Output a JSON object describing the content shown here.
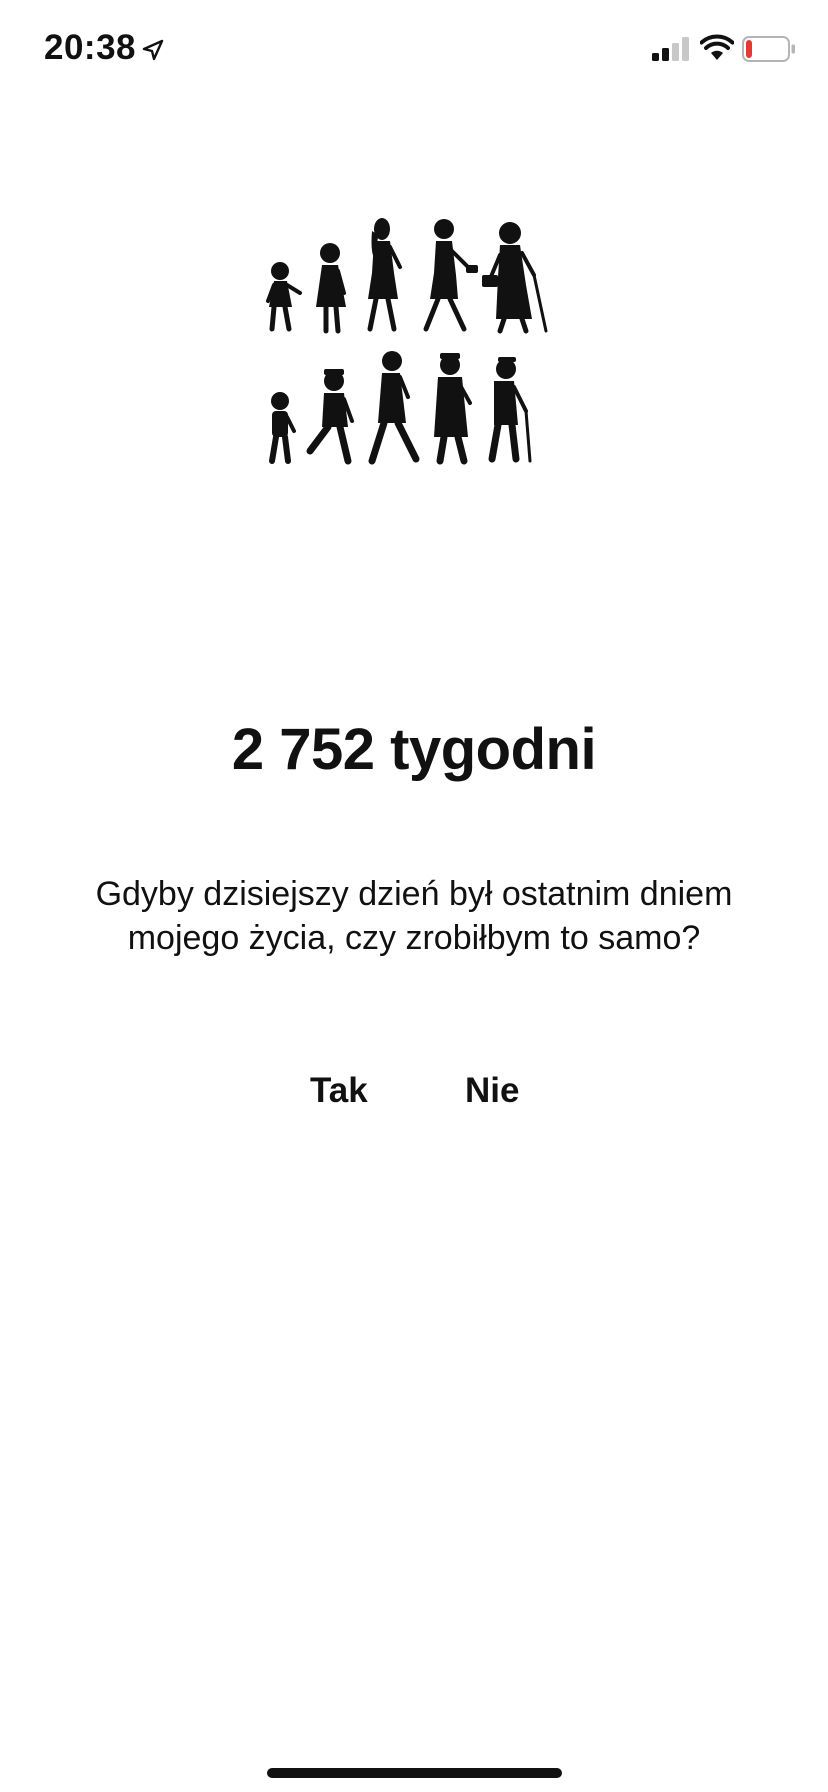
{
  "status_bar": {
    "time": "20:38",
    "icons": [
      "location-arrow-icon",
      "cellular-signal-icon",
      "wifi-icon",
      "battery-icon"
    ],
    "battery_level_fraction": 0.15,
    "battery_low_color": "#e53935"
  },
  "illustration": {
    "icon": "life-stages-silhouettes-icon"
  },
  "main": {
    "weeks_text": "2 752 tygodni",
    "question_line1": "Gdyby dzisiejszy dzień był ostatnim dniem",
    "question_line2": "mojego życia, czy zrobiłbym to samo?"
  },
  "answers": {
    "yes_label": "Tak",
    "no_label": "Nie"
  }
}
